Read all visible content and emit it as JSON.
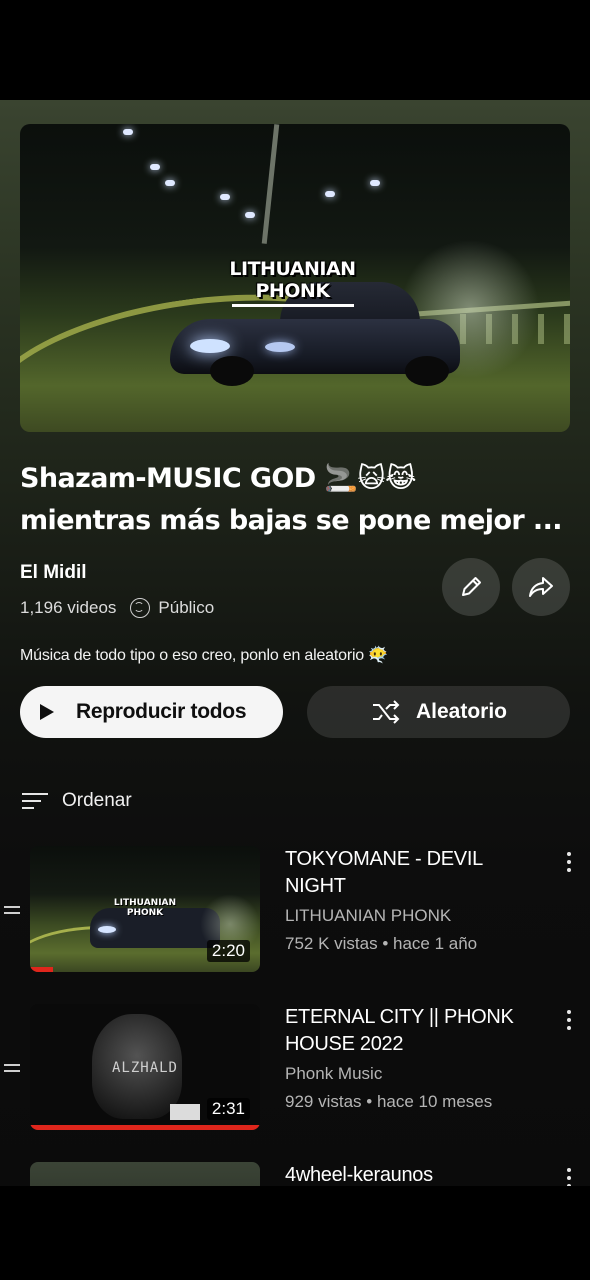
{
  "playlist": {
    "thumbnail_text_line1": "LITHUANIAN",
    "thumbnail_text_line2": "PHONK",
    "title_line1": "Shazam-MUSIC GOD 🚬🙀😹",
    "title_line2": "mientras más bajas se pone mejor ...",
    "owner": "El Midil",
    "video_count": "1,196 videos",
    "visibility": "Público",
    "description": "Música de todo tipo o eso creo, ponlo en aleatorio 😶‍🌫️",
    "edit_icon": "pencil-icon",
    "share_icon": "share-icon"
  },
  "actions": {
    "play_all_label": "Reproducir todos",
    "shuffle_label": "Aleatorio"
  },
  "sort": {
    "label": "Ordenar"
  },
  "videos": [
    {
      "title": "TOKYOMANE - DEVIL NIGHT",
      "channel": "LITHUANIAN PHONK",
      "stats": "752 K vistas • hace 1 año",
      "duration": "2:20",
      "thumb_text_line1": "LITHUANIAN",
      "thumb_text_line2": "PHONK",
      "watched_fraction": 0.1
    },
    {
      "title": "ETERNAL CITY || PHONK HOUSE 2022",
      "channel": "Phonk Music",
      "stats": "929 vistas • hace 10 meses",
      "duration": "2:31",
      "thumb_text": "ALZHALD",
      "watched_fraction": 1.0
    },
    {
      "title": "4wheel-keraunos"
    }
  ],
  "colors": {
    "progress": "#e0261c",
    "play_button_bg": "#f5f5f5"
  }
}
